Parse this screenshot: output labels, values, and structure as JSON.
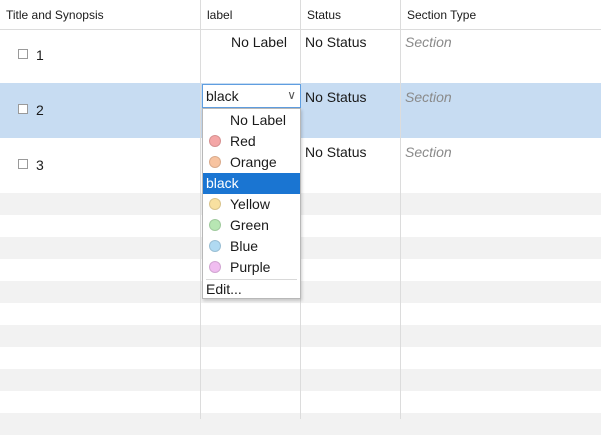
{
  "columns": {
    "title": "Title and Synopsis",
    "label": "label",
    "status": "Status",
    "section_type": "Section Type"
  },
  "rows": [
    {
      "title": "1",
      "label": "No Label",
      "status": "No Status",
      "section_type": "Section"
    },
    {
      "title": "2",
      "label": "black",
      "status": "No Status",
      "section_type": "Section"
    },
    {
      "title": "3",
      "label": "",
      "status": "No Status",
      "section_type": "Section"
    }
  ],
  "label_dropdown": {
    "selected": "black",
    "arrow_icon": "chevron-down-icon",
    "options": [
      {
        "label": "No Label",
        "color": ""
      },
      {
        "label": "Red",
        "color": "#f4a6a6"
      },
      {
        "label": "Orange",
        "color": "#f7c3a0"
      },
      {
        "label": "black",
        "color": ""
      },
      {
        "label": "Yellow",
        "color": "#f8e0a0"
      },
      {
        "label": "Green",
        "color": "#b7e6b3"
      },
      {
        "label": "Blue",
        "color": "#b0daf2"
      },
      {
        "label": "Purple",
        "color": "#f0bdf0"
      }
    ],
    "edit_label": "Edit..."
  },
  "colors": {
    "selected_row": "#c7dcf2",
    "highlight": "#1a75d2",
    "stripe": "#f2f2f2"
  }
}
